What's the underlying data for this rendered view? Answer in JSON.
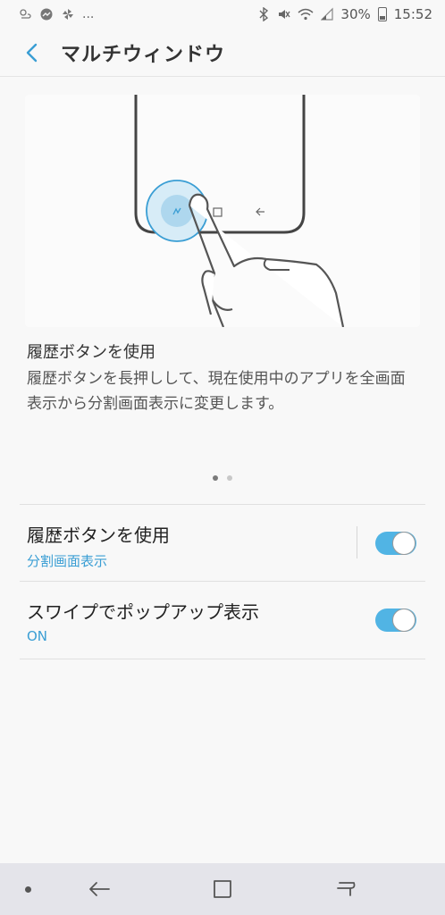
{
  "status_bar": {
    "left_more": "...",
    "battery": "30%",
    "time": "15:52",
    "icons_left": [
      "weather-icon",
      "messenger-icon",
      "pinwheel-icon"
    ],
    "icons_right": [
      "bluetooth-icon",
      "mute-icon",
      "wifi-icon",
      "signal-icon",
      "battery-icon"
    ]
  },
  "app_bar": {
    "title": "マルチウィンドウ",
    "back_icon": "chevron-left-icon"
  },
  "description": {
    "title": "履歴ボタンを使用",
    "body": "履歴ボタンを長押しして、現在使用中のアプリを全画面表示から分割画面表示に変更します。"
  },
  "pager": {
    "count": 2,
    "active": 0
  },
  "settings": [
    {
      "label": "履歴ボタンを使用",
      "sub": "分割画面表示",
      "enabled": true,
      "has_divider": true
    },
    {
      "label": "スワイプでポップアップ表示",
      "sub": "ON",
      "enabled": true,
      "has_divider": false
    }
  ],
  "colors": {
    "accent": "#3a9ed4",
    "toggle_on": "#51b4e4",
    "background": "#f8f8f8",
    "nav_bar": "#e4e4ea"
  },
  "nav_bar": {
    "icons": [
      "dot-icon",
      "back-arrow-icon",
      "home-square-icon",
      "recents-icon"
    ]
  }
}
